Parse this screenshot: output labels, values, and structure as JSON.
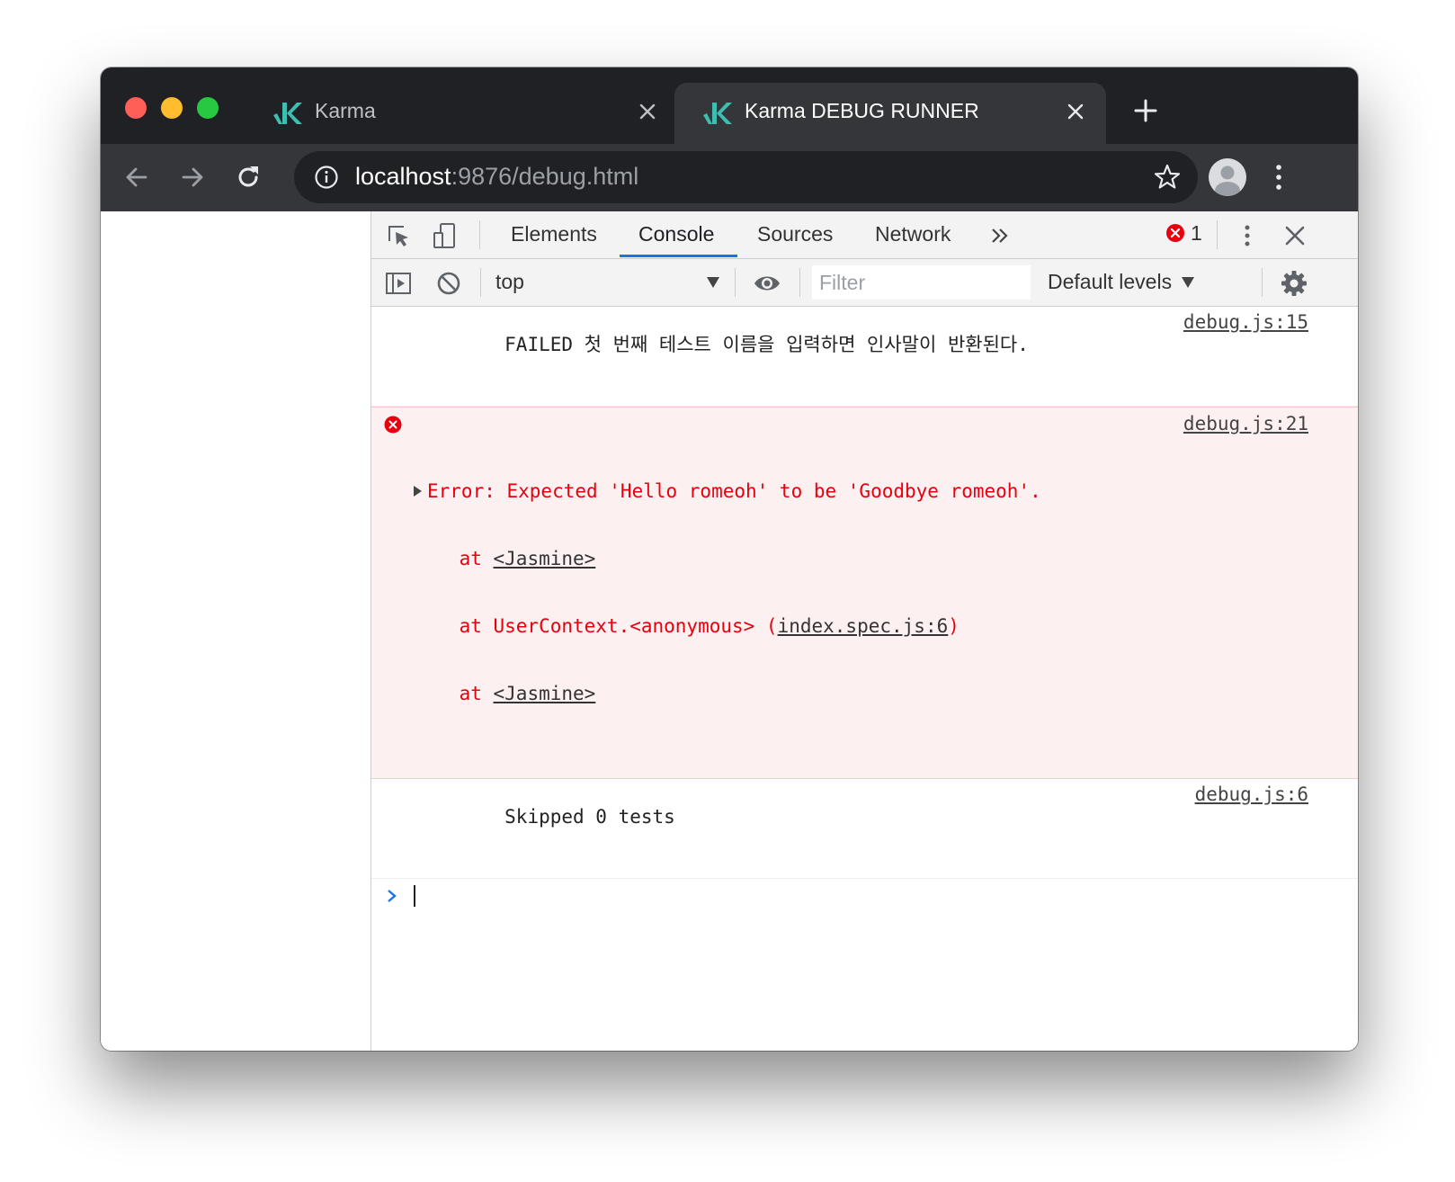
{
  "tabs": [
    {
      "title": "Karma",
      "active": false
    },
    {
      "title": "Karma DEBUG RUNNER",
      "active": true
    }
  ],
  "address": {
    "host": "localhost",
    "rest": ":9876/debug.html"
  },
  "devtools": {
    "tabs": [
      "Elements",
      "Console",
      "Sources",
      "Network"
    ],
    "active_tab": "Console",
    "error_count": "1",
    "context": "top",
    "filter_placeholder": "Filter",
    "levels": "Default levels"
  },
  "console": {
    "messages": [
      {
        "text": "FAILED 첫 번째 테스트 이름을 입력하면 인사말이 반환된다.",
        "source": "debug.js:15"
      },
      {
        "error_line": "Error: Expected 'Hello romeoh' to be 'Goodbye romeoh'.",
        "stack": [
          {
            "prefix": "    at ",
            "link": "<Jasmine>",
            "suffix": ""
          },
          {
            "prefix": "    at UserContext.<anonymous> (",
            "link": "index.spec.js:6",
            "suffix": ")"
          },
          {
            "prefix": "    at ",
            "link": "<Jasmine>",
            "suffix": ""
          }
        ],
        "source": "debug.js:21"
      },
      {
        "text": "Skipped 0 tests",
        "source": "debug.js:6"
      }
    ]
  },
  "colors": {
    "tabstrip": "#202124",
    "toolbar": "#35363a",
    "accent": "#1a73e8",
    "error": "#e8000f",
    "karma_logo": "#3dbeb0"
  }
}
